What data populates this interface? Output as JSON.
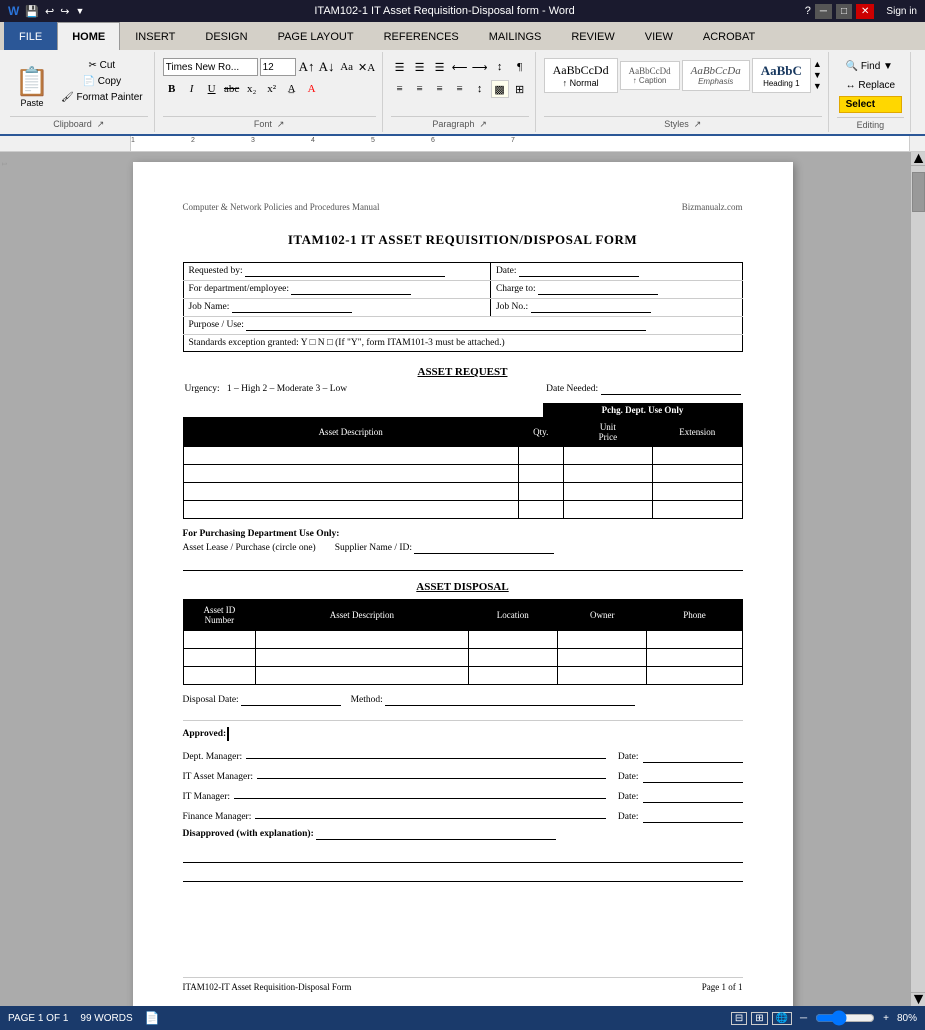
{
  "titleBar": {
    "title": "ITAM102-1 IT Asset Requisition-Disposal form - Word",
    "helpIcon": "?",
    "minimizeIcon": "─",
    "maximizeIcon": "□",
    "closeIcon": "✕"
  },
  "ribbon": {
    "tabs": [
      "FILE",
      "HOME",
      "INSERT",
      "DESIGN",
      "PAGE LAYOUT",
      "REFERENCES",
      "MAILINGS",
      "REVIEW",
      "VIEW",
      "ACROBAT"
    ],
    "activeTab": "HOME",
    "fileTab": "FILE",
    "signIn": "Sign in"
  },
  "toolbar": {
    "font": "Times New Ro...",
    "fontSize": "12",
    "bold": "B",
    "italic": "I",
    "underline": "U",
    "strikethrough": "abc",
    "subscript": "x₂",
    "superscript": "x²",
    "fontColor": "A",
    "highlight": "A",
    "alignLeft": "≡",
    "alignCenter": "≡",
    "alignRight": "≡",
    "justify": "≡",
    "lineSpacing": "↕",
    "bullets": "☰",
    "numbering": "☰",
    "outdent": "←",
    "indent": "→",
    "sortText": "↕",
    "showParagraph": "¶",
    "paste": "Paste",
    "cut": "Cut",
    "copy": "Copy",
    "formatPainter": "Format Painter",
    "styles": {
      "normal": "AaBbCcDd",
      "caption": "↑ Caption",
      "emphasis": "AaBbCcDa",
      "heading1": "AaBbC"
    },
    "find": "Find",
    "replace": "Replace",
    "select": "Select"
  },
  "document": {
    "pageHeader": {
      "left": "Computer & Network Policies and Procedures Manual",
      "right": "Bizmanualz.com"
    },
    "formTitle": "ITAM102-1   IT ASSET REQUISITION/DISPOSAL FORM",
    "infoSection": {
      "row1": {
        "requestedByLabel": "Requested by:",
        "dateLabel": "Date:"
      },
      "row2": {
        "deptLabel": "For department/employee:",
        "chargeToLabel": "Charge to:"
      },
      "row3": {
        "jobNameLabel": "Job Name:",
        "jobNoLabel": "Job No.:"
      },
      "row4": {
        "purposeLabel": "Purpose / Use:"
      },
      "row5": {
        "stdExceptionLabel": "Standards exception granted: Y □  N □  (If \"Y\", form ITAM101-3 must be attached.)"
      }
    },
    "assetRequest": {
      "sectionTitle": "ASSET REQUEST",
      "urgencyLabel": "Urgency:",
      "urgencyOptions": "1 – High    2 – Moderate    3 – Low",
      "dateNeededLabel": "Date Needed:",
      "deptUseOnly": "Pchg. Dept. Use Only",
      "tableHeaders": {
        "description": "Asset Description",
        "qty": "Qty.",
        "unitPrice": "Unit Price",
        "extension": "Extension"
      },
      "rows": 4
    },
    "purchasing": {
      "title": "For Purchasing Department Use Only:",
      "assetLeaseLabel": "Asset Lease / Purchase (circle one)",
      "supplierLabel": "Supplier Name / ID:"
    },
    "assetDisposal": {
      "sectionTitle": "ASSET DISPOSAL",
      "tableHeaders": {
        "assetId": "Asset ID Number",
        "description": "Asset Description",
        "location": "Location",
        "owner": "Owner",
        "phone": "Phone"
      },
      "rows": 3,
      "disposalDateLabel": "Disposal Date:",
      "methodLabel": "Method:"
    },
    "approval": {
      "approvedLabel": "Approved:",
      "deptManagerLabel": "Dept. Manager:",
      "itAssetManagerLabel": "IT Asset Manager:",
      "itManagerLabel": "IT Manager:",
      "financeManagerLabel": "Finance Manager:",
      "dateLabel": "Date:",
      "disapprovedLabel": "Disapproved (with explanation):"
    },
    "pageFooter": {
      "left": "ITAM102-IT Asset Requisition-Disposal Form",
      "right": "Page 1 of 1"
    }
  },
  "statusBar": {
    "pageInfo": "PAGE 1 OF 1",
    "wordCount": "99 WORDS",
    "zoom": "80%"
  }
}
